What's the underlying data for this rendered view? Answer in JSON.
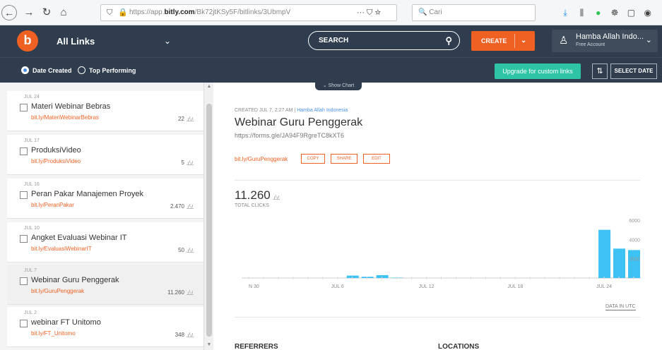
{
  "browser": {
    "url_prefix": "https://app.",
    "url_domain": "bitly.com",
    "url_path": "/Bk72jtKSy5F/bitlinks/3UbmpV",
    "search_placeholder": "Cari",
    "page_actions": "··· ⛉ ☆"
  },
  "header": {
    "logo_letter": "b",
    "all_links_label": "All Links",
    "search_label": "SEARCH",
    "create_label": "CREATE",
    "account_name": "Hamba Allah Indo...",
    "account_type": "Free Account"
  },
  "filters": {
    "date_created": "Date Created",
    "top_performing": "Top Performing",
    "upgrade_label": "Upgrade for custom links",
    "select_date_label": "SELECT DATE",
    "show_chart_label": "Show Chart"
  },
  "links": [
    {
      "date": "JUL 24",
      "title": "Materi Webinar Bebras",
      "short": "bit.ly/MateriWebinarBebras",
      "count": "22"
    },
    {
      "date": "JUL 17",
      "title": "ProduksiVideo",
      "short": "bit.ly/ProduksiVideo",
      "count": "5"
    },
    {
      "date": "JUL 16",
      "title": "Peran Pakar Manajemen Proyek",
      "short": "bit.ly/PeranPakar",
      "count": "2.470"
    },
    {
      "date": "JUL 10",
      "title": "Angket Evaluasi Webinar IT",
      "short": "bit.ly/EvaluasiWebinarIT",
      "count": "50"
    },
    {
      "date": "JUL 7",
      "title": "Webinar Guru Penggerak",
      "short": "bit.ly/GuruPenggerak",
      "count": "11.260"
    },
    {
      "date": "JUL 2",
      "title": "webinar FT Unitomo",
      "short": "bit.ly/FT_Unitomo",
      "count": "348"
    }
  ],
  "detail": {
    "created_prefix": "CREATED JUL 7, 2:27 AM |",
    "created_user": "Hamba Allah Indonesia",
    "title": "Webinar Guru Penggerak",
    "long_url": "https://forms.gle/JA94F9RgreTC8kXT6",
    "short_link": "bit.ly/GuruPenggerak",
    "copy_label": "COPY",
    "share_label": "SHARE",
    "edit_label": "EDIT",
    "total_clicks": "11.260",
    "total_clicks_label": "TOTAL CLICKS",
    "data_utc_label": "DATA IN UTC",
    "referrers_label": "REFERRERS",
    "locations_label": "LOCATIONS"
  },
  "colors": {
    "accent": "#ee6123",
    "header_bg": "#2f3d4e",
    "bar": "#3ec1f3",
    "upgrade": "#2ec4a6"
  },
  "chart_data": {
    "type": "bar",
    "x_tick_labels": [
      "N 30",
      "JUL 6",
      "JUL 12",
      "JUL 18",
      "JUL 24"
    ],
    "y_tick_labels": [
      "6000",
      "4000",
      "2000"
    ],
    "ylim": [
      0,
      6000
    ],
    "bars": [
      {
        "day": 0,
        "value": 0
      },
      {
        "day": 1,
        "value": 0
      },
      {
        "day": 2,
        "value": 0
      },
      {
        "day": 3,
        "value": 0
      },
      {
        "day": 4,
        "value": 0
      },
      {
        "day": 5,
        "value": 0
      },
      {
        "day": 6,
        "value": 0
      },
      {
        "day": 7,
        "value": 250
      },
      {
        "day": 8,
        "value": 130
      },
      {
        "day": 9,
        "value": 300
      },
      {
        "day": 10,
        "value": 40
      },
      {
        "day": 11,
        "value": 0
      },
      {
        "day": 12,
        "value": 0
      },
      {
        "day": 13,
        "value": 0
      },
      {
        "day": 14,
        "value": 0
      },
      {
        "day": 15,
        "value": 0
      },
      {
        "day": 16,
        "value": 0
      },
      {
        "day": 17,
        "value": 0
      },
      {
        "day": 18,
        "value": 0
      },
      {
        "day": 19,
        "value": 0
      },
      {
        "day": 20,
        "value": 0
      },
      {
        "day": 21,
        "value": 0
      },
      {
        "day": 22,
        "value": 0
      },
      {
        "day": 23,
        "value": 0
      },
      {
        "day": 24,
        "value": 5000
      },
      {
        "day": 25,
        "value": 3050
      },
      {
        "day": 26,
        "value": 2900
      }
    ]
  }
}
